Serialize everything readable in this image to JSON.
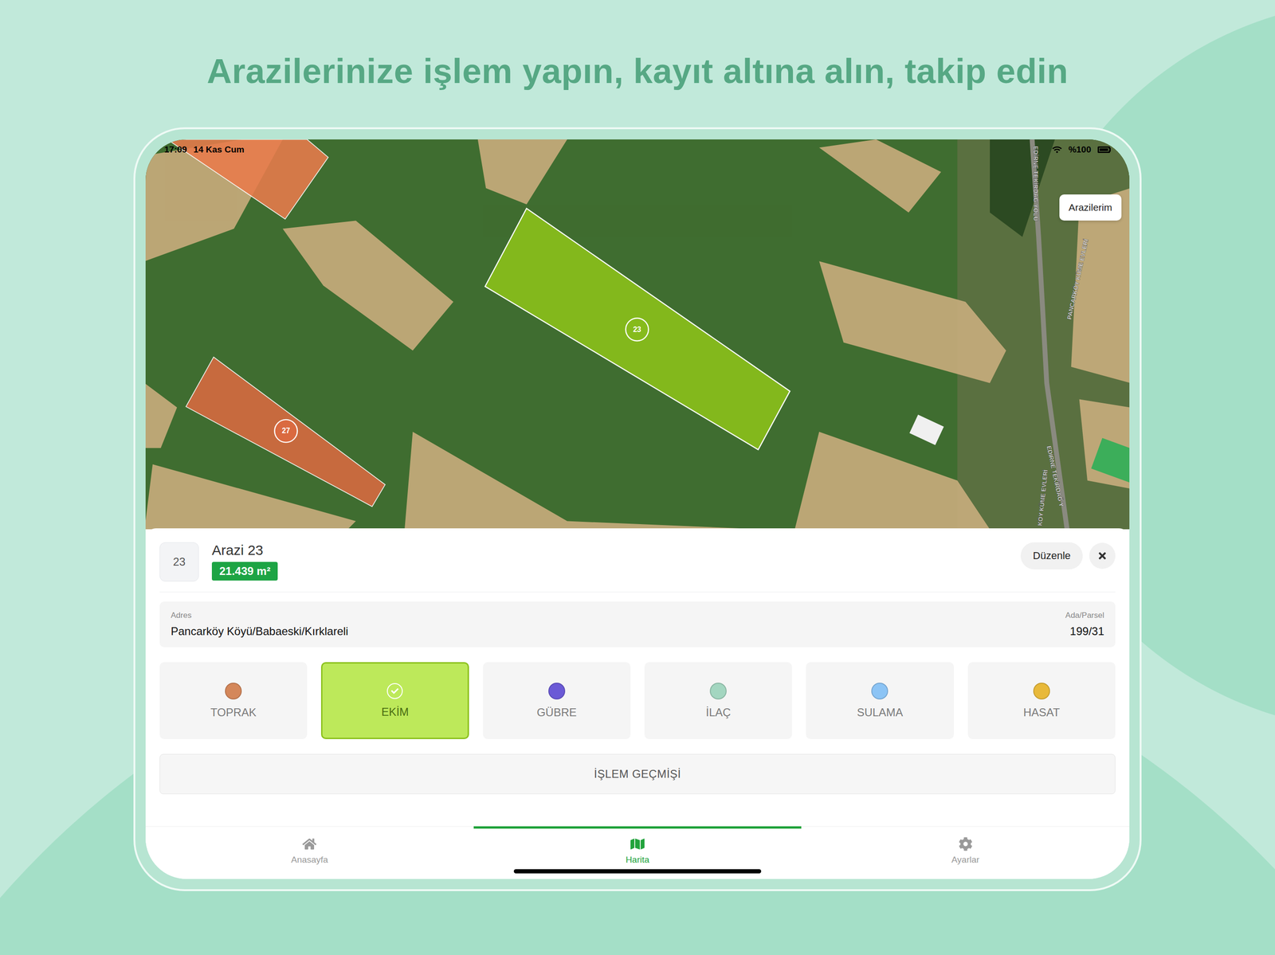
{
  "headline": "Arazilerinize işlem yapın, kayıt altına alın, takip edin",
  "status_bar": {
    "time": "17:09",
    "date": "14 Kas Cum",
    "battery": "%100"
  },
  "map": {
    "button": "Arazilerim",
    "parcels": [
      {
        "color": "#e97b4c",
        "selected": false
      },
      {
        "label": "23",
        "color": "#86bb1c",
        "selected": true
      },
      {
        "label": "27",
        "color": "#da6a40",
        "selected": false
      }
    ],
    "road_labels": [
      "EDİRNE TEKİRDAĞ YOLU",
      "PANCARKÖY KÜME EVLERİ",
      "EDİRNE TEKİRDAĞ Y",
      "KÖY KÜME EVLERİ"
    ]
  },
  "parcel": {
    "number": "23",
    "title": "Arazi 23",
    "area": "21.439 m²",
    "edit": "Düzenle",
    "address": {
      "label": "Adres",
      "value": "Pancarköy Köyü/Babaeski/Kırklareli"
    },
    "plot": {
      "label": "Ada/Parsel",
      "value": "199/31"
    }
  },
  "operations": [
    {
      "label": "TOPRAK",
      "color": "#d4875a",
      "selected": false
    },
    {
      "label": "EKİM",
      "color": "#bde95a",
      "selected": true
    },
    {
      "label": "GÜBRE",
      "color": "#6b5ad6",
      "selected": false
    },
    {
      "label": "İLAÇ",
      "color": "#a3d6c0",
      "selected": false
    },
    {
      "label": "SULAMA",
      "color": "#8cc4f5",
      "selected": false
    },
    {
      "label": "HASAT",
      "color": "#e8b93a",
      "selected": false
    }
  ],
  "history_button": "İŞLEM GEÇMİŞİ",
  "tabs": [
    {
      "label": "Anasayfa",
      "selected": false
    },
    {
      "label": "Harita",
      "selected": true
    },
    {
      "label": "Ayarlar",
      "selected": false
    }
  ]
}
